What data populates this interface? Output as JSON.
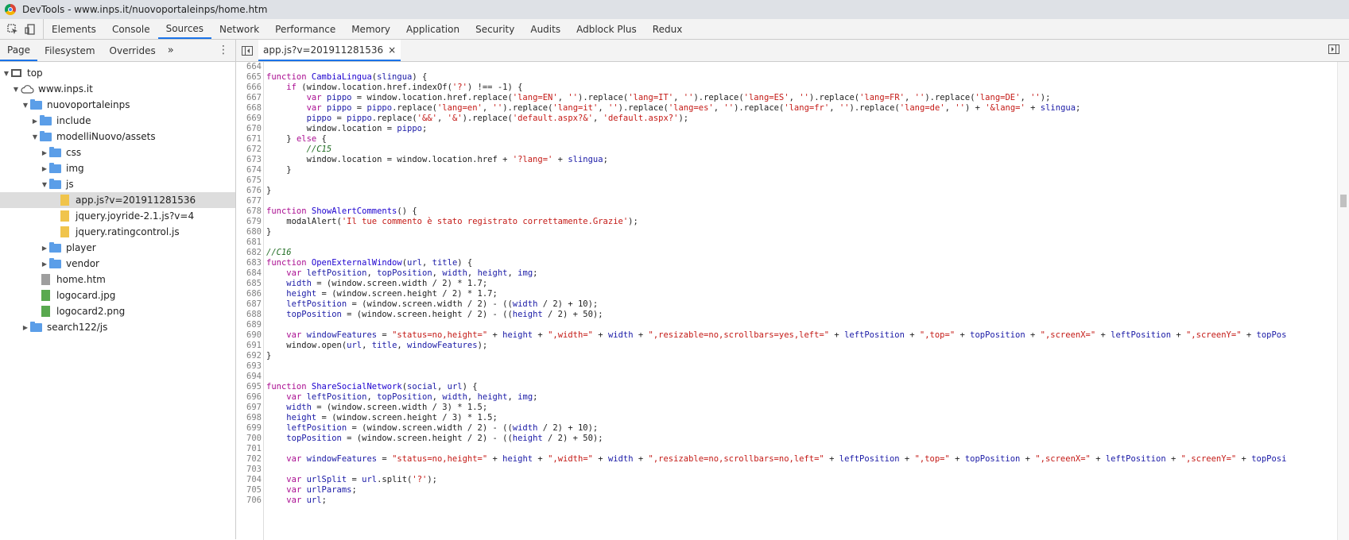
{
  "window": {
    "title": "DevTools - www.inps.it/nuovoportaleinps/home.htm"
  },
  "main_tabs": [
    "Elements",
    "Console",
    "Sources",
    "Network",
    "Performance",
    "Memory",
    "Application",
    "Security",
    "Audits",
    "Adblock Plus",
    "Redux"
  ],
  "active_main_tab": "Sources",
  "sidebar": {
    "tabs": [
      "Page",
      "Filesystem",
      "Overrides"
    ],
    "more": "»",
    "menu": "⋮"
  },
  "tree": [
    {
      "label": "top",
      "depth": 0,
      "type": "frame",
      "arrow": "down"
    },
    {
      "label": "www.inps.it",
      "depth": 1,
      "type": "cloud",
      "arrow": "down"
    },
    {
      "label": "nuovoportaleinps",
      "depth": 2,
      "type": "folder",
      "arrow": "down"
    },
    {
      "label": "include",
      "depth": 3,
      "type": "folder",
      "arrow": "right"
    },
    {
      "label": "modelliNuovo/assets",
      "depth": 3,
      "type": "folder",
      "arrow": "down"
    },
    {
      "label": "css",
      "depth": 4,
      "type": "folder",
      "arrow": "right"
    },
    {
      "label": "img",
      "depth": 4,
      "type": "folder",
      "arrow": "right"
    },
    {
      "label": "js",
      "depth": 4,
      "type": "folder",
      "arrow": "down"
    },
    {
      "label": "app.js?v=201911281536",
      "depth": 5,
      "type": "js",
      "arrow": "",
      "selected": true
    },
    {
      "label": "jquery.joyride-2.1.js?v=4",
      "depth": 5,
      "type": "js",
      "arrow": ""
    },
    {
      "label": "jquery.ratingcontrol.js",
      "depth": 5,
      "type": "js",
      "arrow": ""
    },
    {
      "label": "player",
      "depth": 4,
      "type": "folder",
      "arrow": "right"
    },
    {
      "label": "vendor",
      "depth": 4,
      "type": "folder",
      "arrow": "right"
    },
    {
      "label": "home.htm",
      "depth": 3,
      "type": "htm",
      "arrow": ""
    },
    {
      "label": "logocard.jpg",
      "depth": 3,
      "type": "img",
      "arrow": ""
    },
    {
      "label": "logocard2.png",
      "depth": 3,
      "type": "img",
      "arrow": ""
    },
    {
      "label": "search122/js",
      "depth": 2,
      "type": "folder",
      "arrow": "right"
    }
  ],
  "editor": {
    "open_file": "app.js?v=201911281536",
    "close": "×",
    "lines": [
      {
        "n": "664",
        "html": ""
      },
      {
        "n": "665",
        "html": "<span class='k'>function</span> <span class='f'>CambiaLingua</span>(<span class='v'>slingua</span>) {"
      },
      {
        "n": "666",
        "html": "    <span class='k'>if</span> (window.location.href.indexOf(<span class='s'>'?'</span>) !== -1) {"
      },
      {
        "n": "667",
        "html": "        <span class='k'>var</span> <span class='v'>pippo</span> = window.location.href.replace(<span class='s'>'lang=EN'</span>, <span class='s'>''</span>).replace(<span class='s'>'lang=IT'</span>, <span class='s'>''</span>).replace(<span class='s'>'lang=ES'</span>, <span class='s'>''</span>).replace(<span class='s'>'lang=FR'</span>, <span class='s'>''</span>).replace(<span class='s'>'lang=DE'</span>, <span class='s'>''</span>);"
      },
      {
        "n": "668",
        "html": "        <span class='k'>var</span> <span class='v'>pippo</span> = <span class='v'>pippo</span>.replace(<span class='s'>'lang=en'</span>, <span class='s'>''</span>).replace(<span class='s'>'lang=it'</span>, <span class='s'>''</span>).replace(<span class='s'>'lang=es'</span>, <span class='s'>''</span>).replace(<span class='s'>'lang=fr'</span>, <span class='s'>''</span>).replace(<span class='s'>'lang=de'</span>, <span class='s'>''</span>) + <span class='s'>'&amp;lang='</span> + <span class='v'>slingua</span>;"
      },
      {
        "n": "669",
        "html": "        <span class='v'>pippo</span> = <span class='v'>pippo</span>.replace(<span class='s'>'&amp;&amp;'</span>, <span class='s'>'&amp;'</span>).replace(<span class='s'>'default.aspx?&amp;'</span>, <span class='s'>'default.aspx?'</span>);"
      },
      {
        "n": "670",
        "html": "        window.location = <span class='v'>pippo</span>;"
      },
      {
        "n": "671",
        "html": "    } <span class='k'>else</span> {"
      },
      {
        "n": "672",
        "html": "        <span class='c'>//C15</span>"
      },
      {
        "n": "673",
        "html": "        window.location = window.location.href + <span class='s'>'?lang='</span> + <span class='v'>slingua</span>;"
      },
      {
        "n": "674",
        "html": "    }"
      },
      {
        "n": "675",
        "html": ""
      },
      {
        "n": "676",
        "html": "}"
      },
      {
        "n": "677",
        "html": ""
      },
      {
        "n": "678",
        "html": "<span class='k'>function</span> <span class='f'>ShowAlertComments</span>() {"
      },
      {
        "n": "679",
        "html": "    modalAlert(<span class='s'>'Il tue commento è stato registrato correttamente.Grazie'</span>);"
      },
      {
        "n": "680",
        "html": "}"
      },
      {
        "n": "681",
        "html": ""
      },
      {
        "n": "682",
        "html": "<span class='c'>//C16</span>"
      },
      {
        "n": "683",
        "html": "<span class='k'>function</span> <span class='f'>OpenExternalWindow</span>(<span class='v'>url</span>, <span class='v'>title</span>) {"
      },
      {
        "n": "684",
        "html": "    <span class='k'>var</span> <span class='v'>leftPosition</span>, <span class='v'>topPosition</span>, <span class='v'>width</span>, <span class='v'>height</span>, <span class='v'>img</span>;"
      },
      {
        "n": "685",
        "html": "    <span class='v'>width</span> = (window.screen.width / 2) * 1.7;"
      },
      {
        "n": "686",
        "html": "    <span class='v'>height</span> = (window.screen.height / 2) * 1.7;"
      },
      {
        "n": "687",
        "html": "    <span class='v'>leftPosition</span> = (window.screen.width / 2) - ((<span class='v'>width</span> / 2) + 10);"
      },
      {
        "n": "688",
        "html": "    <span class='v'>topPosition</span> = (window.screen.height / 2) - ((<span class='v'>height</span> / 2) + 50);"
      },
      {
        "n": "689",
        "html": ""
      },
      {
        "n": "690",
        "html": "    <span class='k'>var</span> <span class='v'>windowFeatures</span> = <span class='s'>\"status=no,height=\"</span> + <span class='v'>height</span> + <span class='s'>\",width=\"</span> + <span class='v'>width</span> + <span class='s'>\",resizable=no,scrollbars=yes,left=\"</span> + <span class='v'>leftPosition</span> + <span class='s'>\",top=\"</span> + <span class='v'>topPosition</span> + <span class='s'>\",screenX=\"</span> + <span class='v'>leftPosition</span> + <span class='s'>\",screenY=\"</span> + <span class='v'>topPos</span>"
      },
      {
        "n": "691",
        "html": "    window.open(<span class='v'>url</span>, <span class='v'>title</span>, <span class='v'>windowFeatures</span>);"
      },
      {
        "n": "692",
        "html": "}"
      },
      {
        "n": "693",
        "html": ""
      },
      {
        "n": "694",
        "html": ""
      },
      {
        "n": "695",
        "html": "<span class='k'>function</span> <span class='f'>ShareSocialNetwork</span>(<span class='v'>social</span>, <span class='v'>url</span>) {"
      },
      {
        "n": "696",
        "html": "    <span class='k'>var</span> <span class='v'>leftPosition</span>, <span class='v'>topPosition</span>, <span class='v'>width</span>, <span class='v'>height</span>, <span class='v'>img</span>;"
      },
      {
        "n": "697",
        "html": "    <span class='v'>width</span> = (window.screen.width / 3) * 1.5;"
      },
      {
        "n": "698",
        "html": "    <span class='v'>height</span> = (window.screen.height / 3) * 1.5;"
      },
      {
        "n": "699",
        "html": "    <span class='v'>leftPosition</span> = (window.screen.width / 2) - ((<span class='v'>width</span> / 2) + 10);"
      },
      {
        "n": "700",
        "html": "    <span class='v'>topPosition</span> = (window.screen.height / 2) - ((<span class='v'>height</span> / 2) + 50);"
      },
      {
        "n": "701",
        "html": ""
      },
      {
        "n": "702",
        "html": "    <span class='k'>var</span> <span class='v'>windowFeatures</span> = <span class='s'>\"status=no,height=\"</span> + <span class='v'>height</span> + <span class='s'>\",width=\"</span> + <span class='v'>width</span> + <span class='s'>\",resizable=no,scrollbars=no,left=\"</span> + <span class='v'>leftPosition</span> + <span class='s'>\",top=\"</span> + <span class='v'>topPosition</span> + <span class='s'>\",screenX=\"</span> + <span class='v'>leftPosition</span> + <span class='s'>\",screenY=\"</span> + <span class='v'>topPosi</span>"
      },
      {
        "n": "703",
        "html": ""
      },
      {
        "n": "704",
        "html": "    <span class='k'>var</span> <span class='v'>urlSplit</span> = <span class='v'>url</span>.split(<span class='s'>'?'</span>);"
      },
      {
        "n": "705",
        "html": "    <span class='k'>var</span> <span class='v'>urlParams</span>;"
      },
      {
        "n": "706",
        "html": "    <span class='k'>var</span> <span class='v'>url</span>;"
      }
    ]
  },
  "icons": {
    "inspect": "inspect-icon",
    "device": "device-toolbar-icon",
    "navigator": "toggle-navigator-icon",
    "debugger": "toggle-debugger-icon"
  }
}
